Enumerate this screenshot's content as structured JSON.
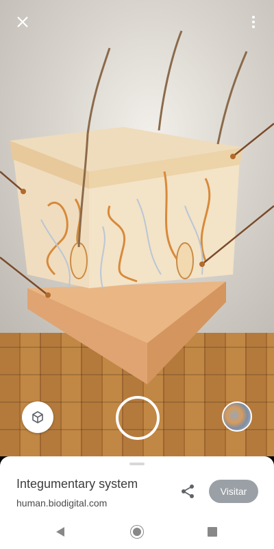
{
  "ar_view": {
    "close_icon": "close-icon",
    "menu_icon": "more-vert-icon",
    "ar_toggle_icon": "cube-3d-icon",
    "shutter_icon": "shutter-ring",
    "thumbnail_icon": "capture-thumbnail"
  },
  "bottom_sheet": {
    "title": "Integumentary system",
    "url": "human.biodigital.com",
    "share_icon": "share-icon",
    "visit_label": "Visitar"
  },
  "nav": {
    "back_icon": "back-triangle-icon",
    "home_icon": "home-circle-icon",
    "recents_icon": "recents-square-icon"
  },
  "colors": {
    "skin_top": "#eddcbc",
    "skin_side": "#f3e6cc",
    "fat_layer": "#e8b07a",
    "accent_orange": "#d78a3a",
    "visit_button": "#9aa0a6"
  }
}
